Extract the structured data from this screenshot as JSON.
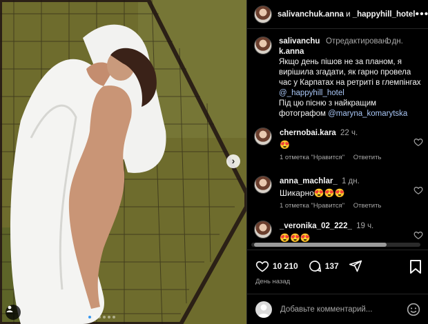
{
  "header": {
    "user1": "salivanchuk.anna",
    "conj": "и",
    "user2": "_happyhill_hotel"
  },
  "caption": {
    "username": "salivanchuk.anna",
    "edited": "Отредактировано",
    "time": "1 дн.",
    "text_before_link1": "Якщо день пішов не за планом, я вирішила згадати, як гарно провела час у Карпатах на ретриті в глемпінгах ",
    "link1": "@_happyhill_hotel",
    "text_before_link2": "Під цю пісню з найкращим фотографом ",
    "link2": "@maryna_komarytska"
  },
  "comments": [
    {
      "username": "chernobai.kara",
      "time": "22 ч.",
      "text": "😍",
      "likes": "1 отметка \"Нравится\"",
      "reply": "Ответить"
    },
    {
      "username": "anna_machlar_",
      "time": "1 дн.",
      "text": "Шикарно😍😍😍",
      "likes": "1 отметка \"Нравится\"",
      "reply": "Ответить"
    },
    {
      "username": "_veronika_02_222_",
      "time": "19 ч.",
      "text": "😍😍😍",
      "likes": "",
      "reply": ""
    }
  ],
  "actions": {
    "likes_count": "10 210",
    "comments_count": "137",
    "posted_ago": "День назад"
  },
  "add_comment": {
    "placeholder": "Добавьте комментарий..."
  },
  "icons": [
    "more-icon",
    "chevron-right-icon",
    "user-tag-icon",
    "heart-icon",
    "comment-icon",
    "share-icon",
    "bookmark-icon",
    "emoji-icon"
  ],
  "colors": {
    "background": "#000000",
    "link": "#a9c6f5",
    "muted": "#a8a8a8",
    "carousel_active": "#3897f0"
  }
}
